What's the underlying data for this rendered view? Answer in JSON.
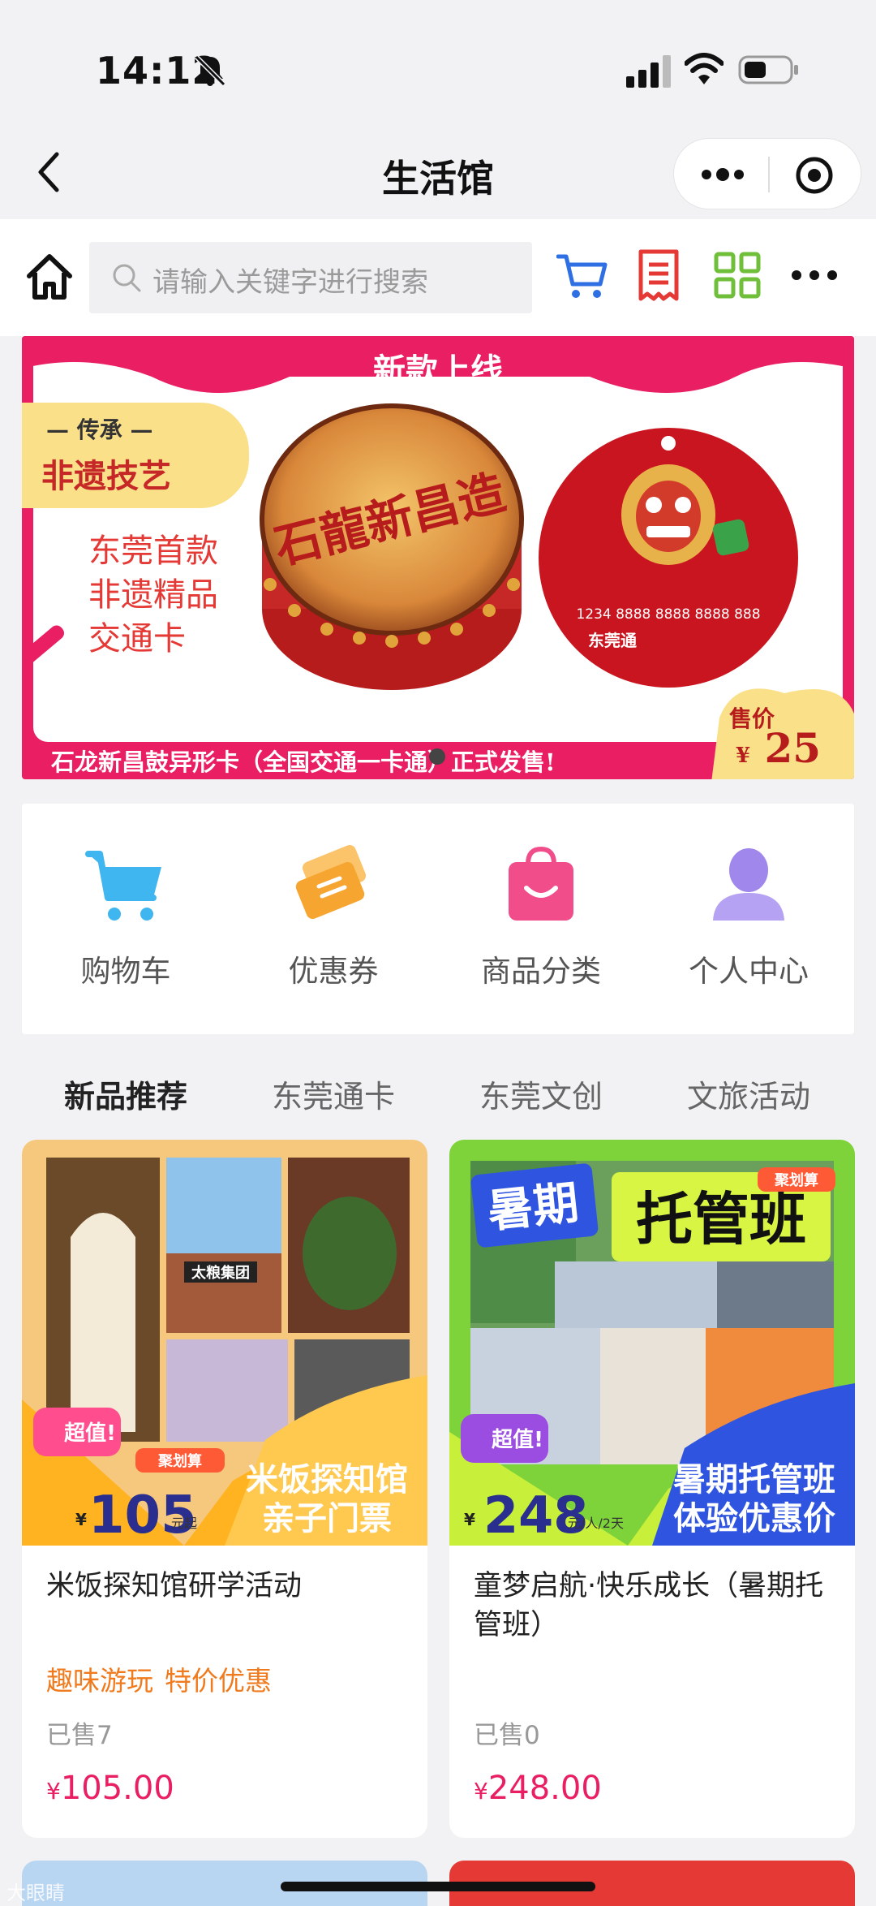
{
  "status_bar": {
    "time": "14:12"
  },
  "title_bar": {
    "title": "生活馆"
  },
  "search": {
    "placeholder": "请输入关键字进行搜索"
  },
  "banner": {
    "headline": "新款上线",
    "heritage_small": "— 传承 —",
    "heritage_big": "非遗技艺",
    "desc_lines": [
      "东莞首款",
      "非遗精品",
      "交通卡"
    ],
    "drum_text": "石龍新昌造",
    "card_number": "1234 8888 8888 8888 888",
    "card_brand": "东莞通",
    "price_label": "售价",
    "price_currency": "¥",
    "price_value": "25",
    "footer": "石龙新昌鼓异形卡（全国交通一卡通）正式发售!"
  },
  "quick_nav": {
    "items": [
      {
        "label": "购物车",
        "icon": "cart-icon",
        "color": "#3fb6f0"
      },
      {
        "label": "优惠券",
        "icon": "ticket-icon",
        "color": "#f7a531"
      },
      {
        "label": "商品分类",
        "icon": "bag-icon",
        "color": "#f04d8a"
      },
      {
        "label": "个人中心",
        "icon": "person-icon",
        "color": "#a087ec"
      }
    ]
  },
  "tabs": [
    "新品推荐",
    "东莞通卡",
    "东莞文创",
    "文旅活动"
  ],
  "products": [
    {
      "name": "米饭探知馆研学活动",
      "tags": [
        "趣味游玩",
        "特价优惠"
      ],
      "sold": "已售7",
      "price_currency": "¥",
      "price": "105.00",
      "image": {
        "badge": "超值!",
        "badge2": "聚划算",
        "price_currency": "¥",
        "price": "105",
        "price_unit": "元起",
        "caption_lines": [
          "米饭探知馆",
          "亲子门票"
        ],
        "sign_text": "太粮集团"
      }
    },
    {
      "name": "童梦启航·快乐成长（暑期托管班）",
      "tags": [],
      "sold": "已售0",
      "price_currency": "¥",
      "price": "248.00",
      "image": {
        "title_a": "暑期",
        "title_b": "托管班",
        "badge": "超值!",
        "badge2": "聚划算",
        "price_currency": "¥",
        "price": "248",
        "price_unit": "元/人/2天",
        "caption_lines": [
          "暑期托管班",
          "体验优惠价"
        ]
      }
    }
  ],
  "watermark": "大眼睛"
}
